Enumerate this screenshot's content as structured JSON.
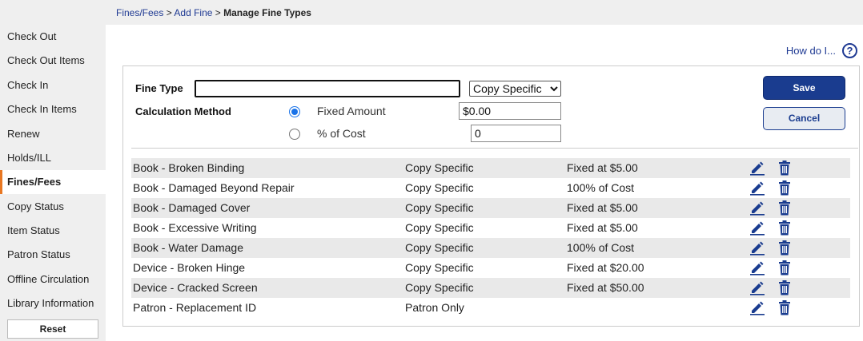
{
  "breadcrumb": {
    "items": [
      "Fines/Fees",
      "Add Fine"
    ],
    "separator": ">",
    "current": "Manage Fine Types"
  },
  "sidebar": {
    "items": [
      {
        "label": "Check Out",
        "active": false
      },
      {
        "label": "Check Out Items",
        "active": false
      },
      {
        "label": "Check In",
        "active": false
      },
      {
        "label": "Check In Items",
        "active": false
      },
      {
        "label": "Renew",
        "active": false
      },
      {
        "label": "Holds/ILL",
        "active": false
      },
      {
        "label": "Fines/Fees",
        "active": true
      },
      {
        "label": "Copy Status",
        "active": false
      },
      {
        "label": "Item Status",
        "active": false
      },
      {
        "label": "Patron Status",
        "active": false
      },
      {
        "label": "Offline Circulation",
        "active": false
      },
      {
        "label": "Library Information",
        "active": false
      }
    ],
    "reset_label": "Reset"
  },
  "help": {
    "label": "How do I...",
    "icon": "help-circle-icon"
  },
  "form": {
    "fine_type_label": "Fine Type",
    "fine_type_value": "",
    "scope_selected": "Copy Specific",
    "calc_label": "Calculation Method",
    "fixed_label": "Fixed Amount",
    "fixed_value": "$0.00",
    "percent_label": "% of Cost",
    "percent_value": "0",
    "selected_method": "fixed",
    "save_label": "Save",
    "cancel_label": "Cancel"
  },
  "fine_types": [
    {
      "name": "Book - Broken Binding",
      "scope": "Copy Specific",
      "amount": "Fixed at $5.00"
    },
    {
      "name": "Book - Damaged Beyond Repair",
      "scope": "Copy Specific",
      "amount": "100% of Cost"
    },
    {
      "name": "Book - Damaged Cover",
      "scope": "Copy Specific",
      "amount": "Fixed at $5.00"
    },
    {
      "name": "Book - Excessive Writing",
      "scope": "Copy Specific",
      "amount": "Fixed at $5.00"
    },
    {
      "name": "Book - Water Damage",
      "scope": "Copy Specific",
      "amount": "100% of Cost"
    },
    {
      "name": "Device - Broken Hinge",
      "scope": "Copy Specific",
      "amount": "Fixed at $20.00"
    },
    {
      "name": "Device - Cracked Screen",
      "scope": "Copy Specific",
      "amount": "Fixed at $50.00"
    },
    {
      "name": "Patron - Replacement ID",
      "scope": "Patron Only",
      "amount": ""
    }
  ],
  "colors": {
    "primary": "#1a3c8f",
    "accent": "#e87722",
    "link": "#1f3a93",
    "radio": "#1a73e8"
  }
}
